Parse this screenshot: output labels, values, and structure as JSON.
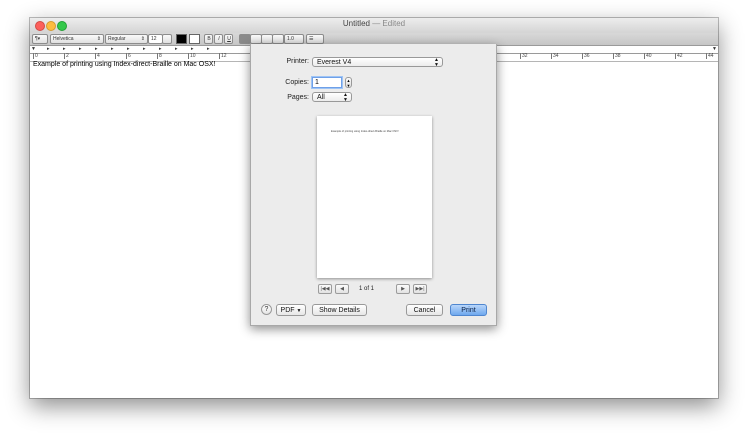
{
  "window": {
    "title": "Untitled",
    "title_suffix": " — Edited"
  },
  "toolbar": {
    "list_style": "¶▾",
    "font_family": "Helvetica",
    "font_style": "Regular",
    "font_size": "12",
    "bold": "B",
    "italic": "I",
    "underline": "U",
    "line_spacing": "1.0",
    "list_button": "☰"
  },
  "ruler": {
    "numbers": [
      "0",
      "2",
      "4",
      "6",
      "8",
      "10",
      "12",
      "32",
      "34",
      "36",
      "38",
      "40",
      "42",
      "44"
    ]
  },
  "document": {
    "text": "Example of printing using Index-direct-Braille on Mac OSX!"
  },
  "print_dialog": {
    "printer_label": "Printer:",
    "printer_value": "Everest V4",
    "copies_label": "Copies:",
    "copies_value": "1",
    "pages_label": "Pages:",
    "pages_value": "All",
    "preview_text": "Example of printing using Index-direct-Braille on Mac OSX!",
    "page_indicator": "1 of 1",
    "nav_first": "|◀◀",
    "nav_prev": "◀",
    "nav_next": "▶",
    "nav_last": "▶▶|",
    "help": "?",
    "pdf_label": "PDF",
    "show_details": "Show Details",
    "cancel": "Cancel",
    "print": "Print"
  },
  "icons": [
    "close-icon",
    "minimize-icon",
    "zoom-icon",
    "help-icon",
    "updown-arrows-icon"
  ],
  "colors": {
    "close": "#fc605c",
    "minimize": "#fdbc40",
    "zoom": "#34c84a",
    "print_button": "#6ea8ee"
  }
}
